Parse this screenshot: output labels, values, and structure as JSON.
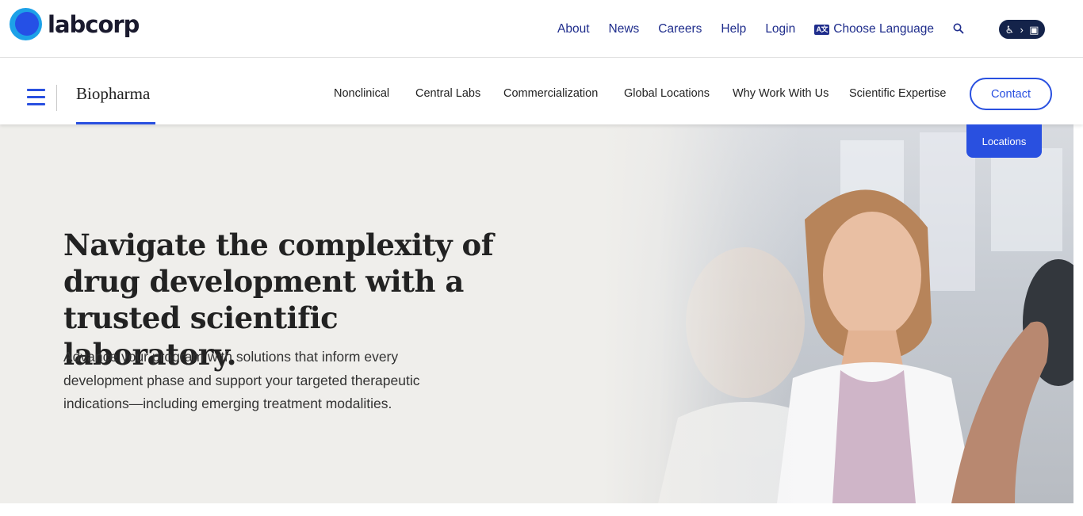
{
  "brand": {
    "logo_text": "labcorp"
  },
  "utility_nav": {
    "links": [
      "About",
      "News",
      "Careers",
      "Help",
      "Login"
    ],
    "language_label": "Choose Language",
    "language_icon_text": "A文"
  },
  "subnav": {
    "section_title": "Biopharma",
    "items": [
      "Nonclinical",
      "Central Labs",
      "Commercialization",
      "Global Locations",
      "Why Work With Us",
      "Scientific Expertise"
    ],
    "contact_label": "Contact"
  },
  "hero": {
    "headline": "Navigate the complexity of drug development with a trusted scientific laboratory.",
    "subtext": "Advance your program with solutions that inform every development phase and support your targeted therapeutic indications—including emerging treatment modalities."
  },
  "floating": {
    "locations_label": "Locations"
  },
  "icons": {
    "menu": "hamburger-icon",
    "search": "search-icon",
    "language": "translate-icon",
    "accessibility": "accessibility-icon"
  },
  "colors": {
    "brand_blue": "#2950e0",
    "nav_link": "#1f2d8c",
    "hero_bg": "#efeeeb",
    "logo_cyan": "#1da1e8"
  }
}
